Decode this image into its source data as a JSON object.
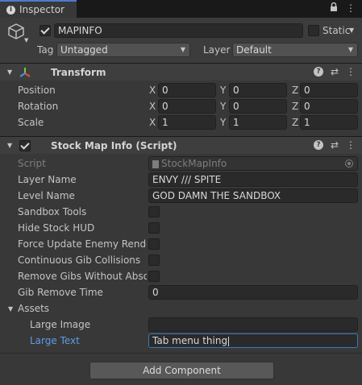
{
  "tab": {
    "title": "Inspector"
  },
  "header": {
    "name": "MAPINFO",
    "static_label": "Static",
    "tag_label": "Tag",
    "tag_value": "Untagged",
    "layer_label": "Layer",
    "layer_value": "Default"
  },
  "transform": {
    "title": "Transform",
    "rows": [
      {
        "label": "Position",
        "x": "0",
        "y": "0",
        "z": "0"
      },
      {
        "label": "Rotation",
        "x": "0",
        "y": "0",
        "z": "0"
      },
      {
        "label": "Scale",
        "x": "1",
        "y": "1",
        "z": "1"
      }
    ],
    "axis_x": "X",
    "axis_y": "Y",
    "axis_z": "Z"
  },
  "script_comp": {
    "title": "Stock Map Info (Script)",
    "script_label": "Script",
    "script_value": "StockMapInfo",
    "layer_name_label": "Layer Name",
    "layer_name_value": "ENVY /// SPITE",
    "level_name_label": "Level Name",
    "level_name_value": "GOD DAMN THE SANDBOX",
    "sandbox_tools_label": "Sandbox Tools",
    "hide_hud_label": "Hide Stock HUD",
    "force_update_label": "Force Update Enemy Render",
    "continuous_gib_label": "Continuous Gib Collisions",
    "remove_gibs_label": "Remove Gibs Without Absorb",
    "gib_remove_time_label": "Gib Remove Time",
    "gib_remove_time_value": "0",
    "assets_label": "Assets",
    "large_image_label": "Large Image",
    "large_image_value": "",
    "large_text_label": "Large Text",
    "large_text_value": "Tab menu thing"
  },
  "add_component_label": "Add Component",
  "colors": {
    "accent": "#4b7ad1",
    "focus_label": "#5d9ce6",
    "bg": "#383838"
  }
}
